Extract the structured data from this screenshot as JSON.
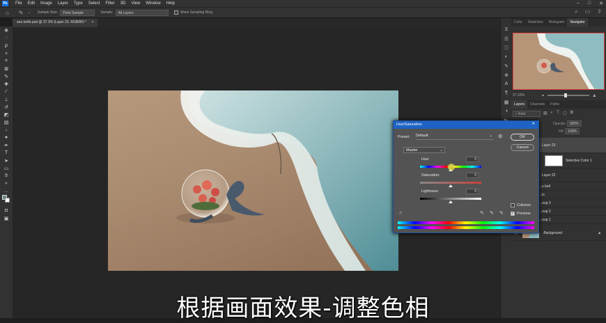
{
  "menubar": {
    "logo": "Ps",
    "items": [
      "File",
      "Edit",
      "Image",
      "Layer",
      "Type",
      "Select",
      "Filter",
      "3D",
      "View",
      "Window",
      "Help"
    ]
  },
  "options": {
    "sample_size_label": "Sample Size:",
    "sample_size_value": "Point Sample",
    "sample_label": "Sample:",
    "sample_value": "All Layers",
    "show_ring_label": "Show Sampling Ring"
  },
  "document": {
    "tab_title": "sea turtle.psd @ 37.3% (Layer 23, RGB/8#) *",
    "close": "×"
  },
  "panels": {
    "top_tabs": [
      "Color",
      "Swatches",
      "Histogram",
      "Navigator"
    ],
    "zoom": "37.33%",
    "layer_tabs": [
      "Layers",
      "Channels",
      "Paths"
    ],
    "kind_placeholder": "Kind",
    "opacity_label": "Opacity:",
    "opacity_value": "100%",
    "fill_label": "Fill:",
    "fill_value": "100%"
  },
  "layers": [
    {
      "name": "Layer 23"
    },
    {
      "name": "Selective Color 1"
    },
    {
      "name": "Layer 22"
    },
    {
      "name": "...s ball"
    },
    {
      "name": "...ls"
    },
    {
      "name": "...oup 3"
    },
    {
      "name": "...oup 2"
    },
    {
      "name": "...oup 1"
    },
    {
      "name": "Background"
    }
  ],
  "dialog": {
    "title": "Hue/Saturation",
    "preset_label": "Preset:",
    "preset_value": "Default",
    "ok": "OK",
    "cancel": "Cancel",
    "channel": "Master",
    "hue_label": "Hue:",
    "hue_value": "0",
    "saturation_label": "Saturation:",
    "saturation_value": "0",
    "lightness_label": "Lightness:",
    "lightness_value": "0",
    "colorize_label": "Colorize",
    "preview_label": "Preview",
    "preview_checked": true
  },
  "subtitle": "根据画面效果-调整色相",
  "colors": {
    "accent": "#1e63c4",
    "nav_border": "#dd4444"
  }
}
